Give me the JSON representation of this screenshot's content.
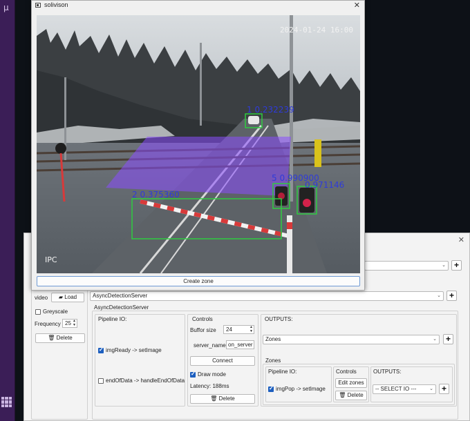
{
  "taskbar": {
    "glyph": "μ"
  },
  "video_window": {
    "title": "solivison",
    "create_zone_label": "Create zone",
    "feed": {
      "timestamp": "2024-01-24 16:00",
      "watermark": "IPC",
      "detections": [
        {
          "label": "1 0.232239",
          "color": "#2ecc40"
        },
        {
          "label": "2 0.375360",
          "color": "#2ecc40"
        },
        {
          "label": "5 0.990900",
          "color": "#2ecc40"
        },
        {
          "label": "0.971146",
          "color": "#2ecc40"
        }
      ],
      "zone_color": "#8a4dff"
    }
  },
  "main_window": {
    "source_block": {
      "type_label": "video",
      "load_label": "Load",
      "greyscale_label": "Greyscale",
      "frequency_label": "Frequency",
      "frequency_value": "25",
      "delete_label": "Delete"
    },
    "server_combo_value": "AsyncDetectionServer",
    "server_block": {
      "title": "AsyncDetectionServer",
      "pipeline_io_label": "Pipeline IO:",
      "io_items": [
        {
          "label": "imgReady -> setImage",
          "checked": true
        },
        {
          "label": "endOfData -> handleEndOfData",
          "checked": false
        }
      ],
      "controls_label": "Controls",
      "buffer_size_label": "Buffor size",
      "buffer_size_value": "24",
      "server_name_label": "server_name",
      "server_name_value": "on_server",
      "connect_label": "Connect",
      "draw_mode_label": "Draw mode",
      "latency_label": "Latency: 188ms",
      "delete_label": "Delete",
      "outputs_label": "OUTPUTS:",
      "outputs_value": "Zones"
    },
    "zones_block": {
      "title": "Zones",
      "pipeline_io_label": "Pipeline IO:",
      "io_item_label": "imgPop -> setImage",
      "controls_label": "Controls",
      "edit_zones_label": "Edit zones",
      "delete_label": "Delete",
      "outputs_label": "OUTPUTS:",
      "outputs_value": "-- SELECT IO ---"
    }
  }
}
